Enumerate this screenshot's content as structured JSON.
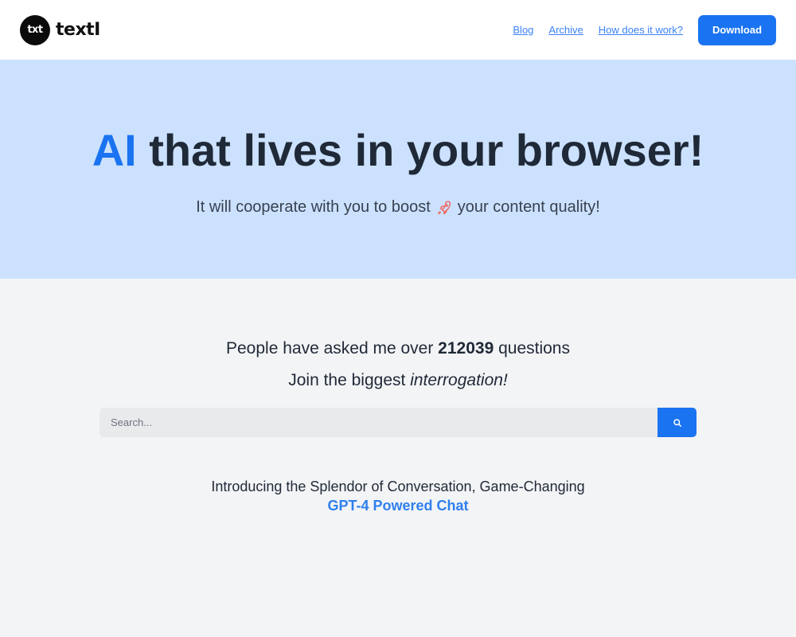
{
  "header": {
    "logo_text": "txt",
    "brand_name": "textI",
    "nav": [
      {
        "label": "Blog"
      },
      {
        "label": "Archive"
      },
      {
        "label": "How does it work?"
      }
    ],
    "download_label": "Download"
  },
  "hero": {
    "title_accent": "AI",
    "title_rest": " that lives in your browser!",
    "subtitle_before": "It will cooperate with you to boost",
    "subtitle_icon": "rocket-icon",
    "subtitle_after": "your content quality!"
  },
  "stats": {
    "prefix": "People have asked me over",
    "count": "212039",
    "suffix": "questions",
    "join_text": "Join the biggest",
    "join_emphasis": "interrogation!"
  },
  "search": {
    "placeholder": "Search...",
    "value": "",
    "button_icon": "search-icon"
  },
  "intro": {
    "line": "Introducing the Splendor of Conversation, Game-Changing",
    "highlight": "GPT-4 Powered Chat"
  },
  "colors": {
    "accent": "#1a73f0",
    "hero_bg": "#cce1fd",
    "page_bg": "#f3f4f6",
    "rocket": "#ef6b6b"
  }
}
